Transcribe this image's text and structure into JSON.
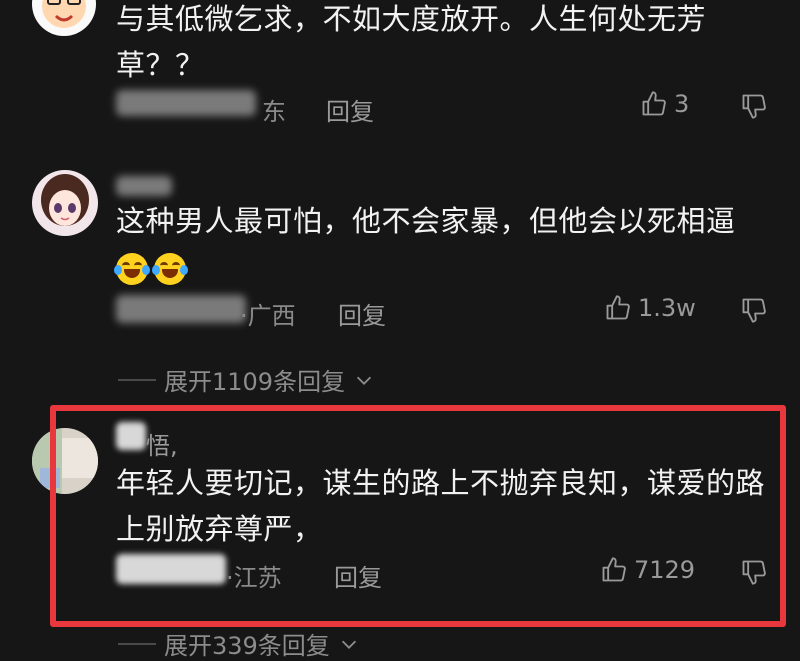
{
  "comments": [
    {
      "text_line1": "与其低微乞求，不如大度放开。人生何处无芳",
      "text_line2": "草？？",
      "location": "东",
      "reply_label": "回复",
      "likes": "3"
    },
    {
      "author_suffix": "",
      "text_line1": "这种男人最可怕，他不会家暴，但他会以死相逼",
      "emoji": [
        "face-with-tears-of-joy",
        "face-with-tears-of-joy"
      ],
      "location": "·广西",
      "reply_label": "回复",
      "likes": "1.3w",
      "expand_label": "展开1109条回复"
    },
    {
      "author_suffix": "悟,",
      "text_line1": "年轻人要切记，谋生的路上不抛弃良知，谋爱的路",
      "text_line2": "上别放弃尊严，",
      "location": "·江苏",
      "reply_label": "回复",
      "likes": "7129",
      "expand_label": "展开339条回复"
    }
  ],
  "colors": {
    "background": "#161616",
    "highlight_border": "#e8383d",
    "text": "#f2f2f2",
    "meta": "#8a8a8a"
  },
  "icons": [
    "thumbs-up-icon",
    "thumbs-down-icon",
    "chevron-down-icon"
  ]
}
